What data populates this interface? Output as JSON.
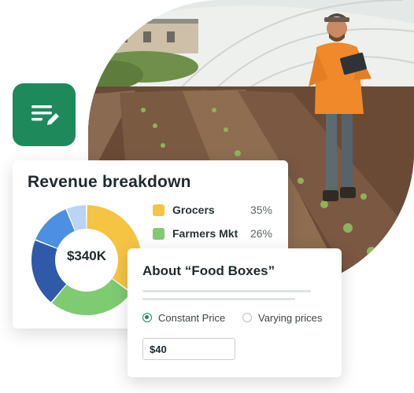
{
  "photo": {
    "alt_icon": "greenhouse-farmer-photo"
  },
  "icon_tile": {
    "icon": "document-edit-icon",
    "color": "#1e8a5c"
  },
  "revenue": {
    "title": "Revenue breakdown",
    "total": "$340K",
    "legend": [
      {
        "label": "Grocers",
        "pct": "35%",
        "color": "#f6c443"
      },
      {
        "label": "Farmers Mkt",
        "pct": "26%",
        "color": "#7ecb72"
      }
    ]
  },
  "chart_data": {
    "type": "pie",
    "donut": true,
    "center_label": "$340K",
    "slices": [
      {
        "label": "Grocers",
        "value": 35,
        "color": "#f6c443"
      },
      {
        "label": "Farmers Mkt",
        "value": 26,
        "color": "#7ecb72"
      },
      {
        "label": "",
        "value": 20,
        "color": "#2e5aa8"
      },
      {
        "label": "",
        "value": 13,
        "color": "#4d8fe0"
      },
      {
        "label": "",
        "value": 6,
        "color": "#b9d4f5"
      }
    ]
  },
  "food_boxes": {
    "title": "About “Food Boxes”",
    "options": [
      {
        "label": "Constant Price",
        "selected": true
      },
      {
        "label": "Varying prices",
        "selected": false
      }
    ],
    "price_value": "$40",
    "accent": "#1e8a5c"
  }
}
